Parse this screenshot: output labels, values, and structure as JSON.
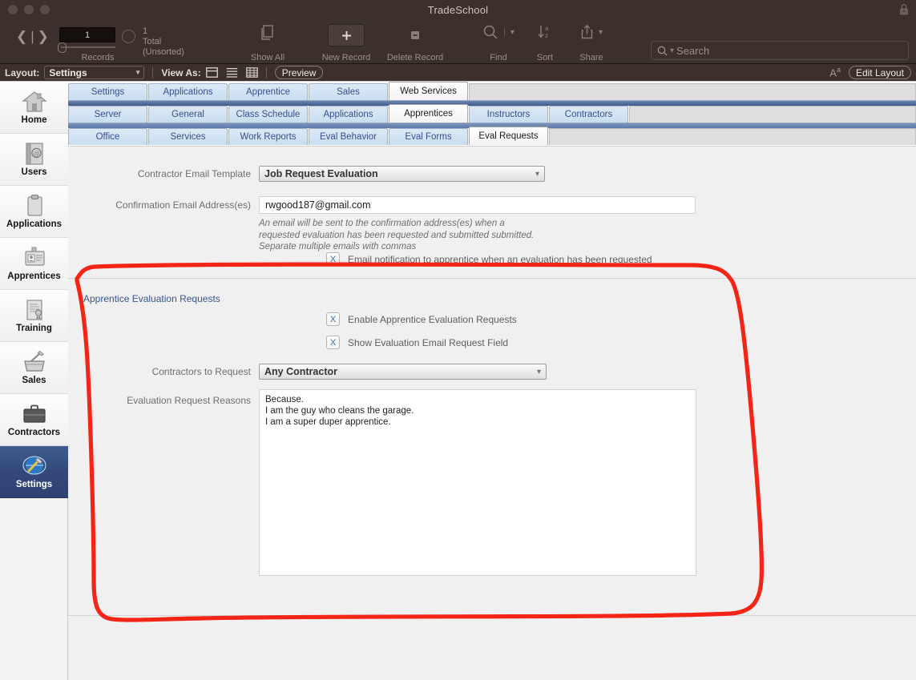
{
  "window": {
    "title": "TradeSchool",
    "lock_icon": "lock-icon"
  },
  "toolbar": {
    "record_number": "1",
    "record_count": "1",
    "record_count_sub": "Total (Unsorted)",
    "records_label": "Records",
    "show_all_label": "Show All",
    "new_record_label": "New Record",
    "delete_record_label": "Delete Record",
    "find_label": "Find",
    "sort_label": "Sort",
    "share_label": "Share",
    "search_placeholder": "Search",
    "icons": {
      "prev": "chevron-left-icon",
      "next": "chevron-right-icon",
      "pie": "pie-chart-icon",
      "show_all": "stack-icon",
      "new_record": "plus-icon",
      "delete_record": "minus-icon",
      "find": "magnifier-icon",
      "sort": "sort-az-icon",
      "share": "share-icon",
      "search": "magnifier-icon"
    }
  },
  "layout_bar": {
    "layout_label": "Layout:",
    "layout_value": "Settings",
    "view_as_label": "View As:",
    "view_form": "form-view-icon",
    "view_list": "list-view-icon",
    "view_table": "table-view-icon",
    "preview_label": "Preview",
    "text_size_icon": "text-size-icon",
    "edit_layout_label": "Edit Layout"
  },
  "sidebar": {
    "items": [
      {
        "label": "Home",
        "icon": "house-icon",
        "selected": false
      },
      {
        "label": "Users",
        "icon": "address-book-icon",
        "selected": false
      },
      {
        "label": "Applications",
        "icon": "clipboard-icon",
        "selected": false
      },
      {
        "label": "Apprentices",
        "icon": "id-badge-icon",
        "selected": false
      },
      {
        "label": "Training",
        "icon": "certificate-icon",
        "selected": false
      },
      {
        "label": "Sales",
        "icon": "basket-icon",
        "selected": false
      },
      {
        "label": "Contractors",
        "icon": "briefcase-icon",
        "selected": false
      },
      {
        "label": "Settings",
        "icon": "globe-hammer-icon",
        "selected": true
      }
    ]
  },
  "tabs": {
    "row1": [
      {
        "label": "Settings",
        "active": false
      },
      {
        "label": "Applications",
        "active": false
      },
      {
        "label": "Apprentice",
        "active": false
      },
      {
        "label": "Sales",
        "active": false
      },
      {
        "label": "Web Services",
        "active": true
      }
    ],
    "row2": [
      {
        "label": "Server",
        "active": false
      },
      {
        "label": "General",
        "active": false
      },
      {
        "label": "Class Schedule",
        "active": false
      },
      {
        "label": "Applications",
        "active": false
      },
      {
        "label": "Apprentices",
        "active": true
      },
      {
        "label": "Instructors",
        "active": false
      },
      {
        "label": "Contractors",
        "active": false
      }
    ],
    "row3": [
      {
        "label": "Office",
        "active": false
      },
      {
        "label": "Services",
        "active": false
      },
      {
        "label": "Work Reports",
        "active": false
      },
      {
        "label": "Eval Behavior",
        "active": false
      },
      {
        "label": "Eval Forms",
        "active": false
      },
      {
        "label": "Eval Requests",
        "active": true
      }
    ]
  },
  "form": {
    "contractor_email_template_label": "Contractor Email Template",
    "contractor_email_template_value": "Job Request Evaluation",
    "confirmation_email_label": "Confirmation Email Address(es)",
    "confirmation_email_value": "rwgood187@gmail.com",
    "help_text": "An email will be sent to the confirmation address(es) when a requested evaluation has been requested and submitted submitted.  Separate multiple emails with commas",
    "notify_checkbox_mark": "X",
    "notify_checkbox_label": "Email notification to apprentice when an evaluation has been requested",
    "section_title": "Apprentice Evaluation Requests",
    "enable_checkbox_mark": "X",
    "enable_checkbox_label": "Enable Apprentice Evaluation Requests",
    "show_field_checkbox_mark": "X",
    "show_field_checkbox_label": "Show Evaluation Email Request Field",
    "contractors_to_request_label": "Contractors to Request",
    "contractors_to_request_value": "Any Contractor",
    "reasons_label": "Evaluation Request Reasons",
    "reasons_value": "Because.\nI am the guy who cleans the garage.\nI am a super duper apprentice."
  },
  "annotation": {
    "shape": "hand-drawn-rectangle",
    "color": "#f42516"
  }
}
